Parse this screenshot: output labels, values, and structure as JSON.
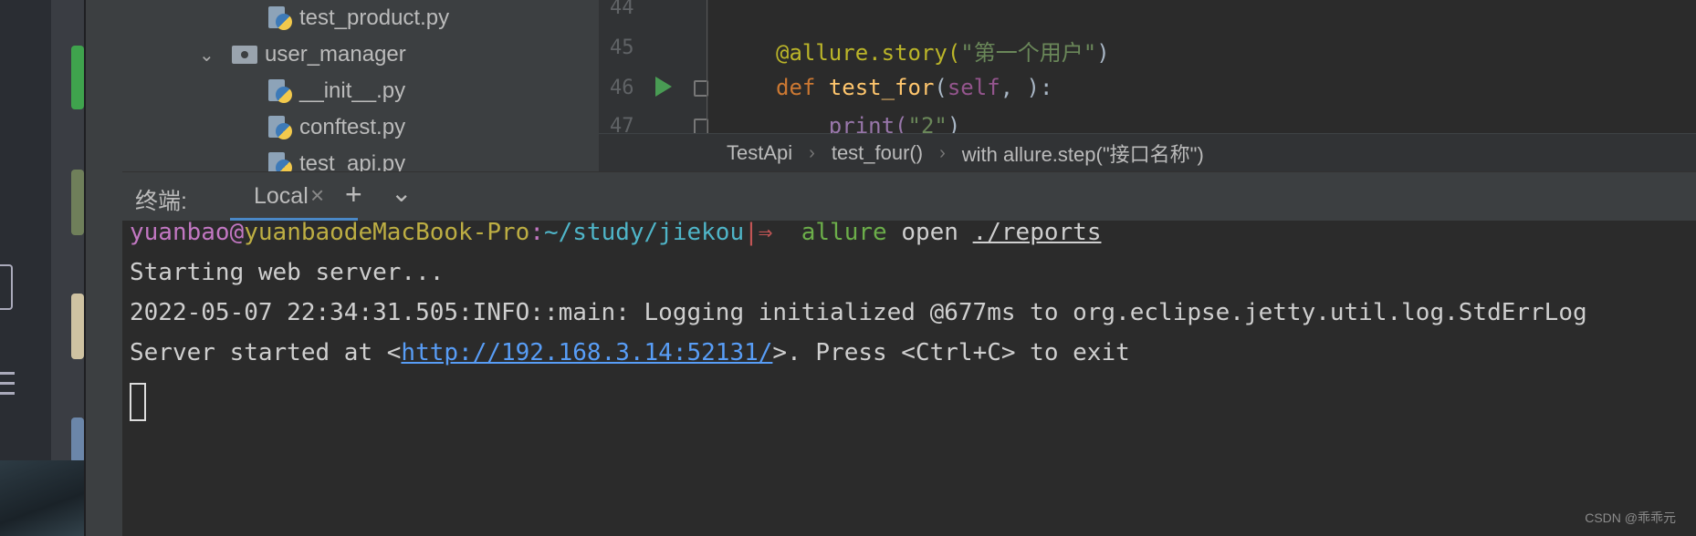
{
  "project_tree": {
    "items": [
      {
        "label": "test_product.py",
        "type": "file"
      },
      {
        "label": "user_manager",
        "type": "folder"
      },
      {
        "label": "__init__.py",
        "type": "file"
      },
      {
        "label": "conftest.py",
        "type": "file"
      },
      {
        "label": "test_api.py",
        "type": "file"
      }
    ]
  },
  "editor": {
    "line_numbers": [
      "44",
      "45",
      "46",
      "47"
    ],
    "lines": [
      {
        "decorator": "@allure.story(",
        "string": "\"第一个用户\"",
        "close": ")"
      },
      {
        "kw": "def ",
        "fn": "test_for",
        "open": "(",
        "self": "self",
        "rest": ", ):"
      },
      {
        "indent": "    ",
        "call": "print(",
        "string": "\"2\"",
        "close": ")"
      }
    ]
  },
  "breadcrumb": {
    "items": [
      "TestApi",
      "test_four()",
      "with allure.step(\"接口名称\")"
    ],
    "separator": "›"
  },
  "terminal_bar": {
    "title": "终端:",
    "tab": "Local",
    "close": "×",
    "add": "+",
    "more": "⌄"
  },
  "terminal": {
    "prompt": {
      "user": "yuanbao",
      "at": "@",
      "host": "yuanbaodeMacBook-Pro",
      "colon": ":",
      "path": "~/study/jiekou",
      "arrow": "|⇒",
      "cmd": "allure",
      "args": " open ",
      "target": "./reports"
    },
    "output": [
      "Starting web server...",
      "2022-05-07 22:34:31.505:INFO::main: Logging initialized @677ms to org.eclipse.jetty.util.log.StdErrLog"
    ],
    "server_line": {
      "prefix": "Server started at <",
      "url": "http://192.168.3.14:52131/",
      "suffix": ">. Press <Ctrl+C> to exit"
    }
  },
  "watermark": "CSDN @乖乖元"
}
